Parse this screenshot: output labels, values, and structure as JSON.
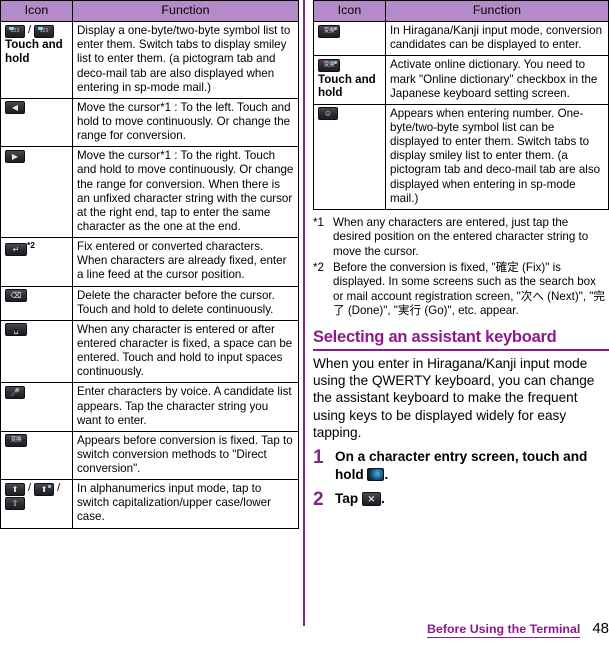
{
  "left_table": {
    "headers": {
      "icon": "Icon",
      "function": "Function"
    },
    "rows": [
      {
        "icons": [
          "123-key",
          "123-key"
        ],
        "icon_separator": "/",
        "icon_note": "Touch and hold",
        "function": "Display a one-byte/two-byte symbol list to enter them. Switch tabs to display smiley list to enter them. (a pictogram tab and deco-mail tab are also displayed when entering in sp-mode mail.)"
      },
      {
        "icons": [
          "arrow-left-key"
        ],
        "function": "Move the cursor*1 : To the left. Touch and hold to move continuously. Or change the range for conversion."
      },
      {
        "icons": [
          "arrow-right-key"
        ],
        "function": "Move the cursor*1 : To the right. Touch and hold to move continuously. Or change the range for conversion. When there is an unfixed character string with the cursor at the right end, tap to enter the same character as the one at the end."
      },
      {
        "icons": [
          "enter-key"
        ],
        "icon_superscript": "*2",
        "function": "Fix entered or converted characters. When characters are already fixed, enter a line feed at the cursor position."
      },
      {
        "icons": [
          "backspace-key"
        ],
        "function": "Delete the character before the cursor. Touch and hold to delete continuously."
      },
      {
        "icons": [
          "space-key"
        ],
        "function": "When any character is entered or after entered character is fixed, a space can be entered. Touch and hold to input spaces continuously."
      },
      {
        "icons": [
          "microphone-key"
        ],
        "function": "Enter characters by voice. A candidate list appears. Tap the character string you want to enter."
      },
      {
        "icons": [
          "conversion-key"
        ],
        "function": "Appears before conversion is fixed. Tap to switch conversion methods to \"Direct conversion\"."
      },
      {
        "icons": [
          "shift-key",
          "shift-key-blue",
          "caps-key"
        ],
        "icon_separator": "/",
        "function": "In alphanumerics input mode, tap to switch capitalization/upper case/lower case."
      }
    ]
  },
  "right_table": {
    "headers": {
      "icon": "Icon",
      "function": "Function"
    },
    "rows": [
      {
        "icons": [
          "conversion-candidate-key"
        ],
        "function": "In Hiragana/Kanji input mode, conversion candidates can be displayed to enter."
      },
      {
        "icons": [
          "conversion-candidate-key"
        ],
        "icon_note": "Touch and hold",
        "function": "Activate online dictionary. You need to mark \"Online dictionary\" checkbox in the Japanese keyboard setting screen."
      },
      {
        "icons": [
          "symbol-key"
        ],
        "function": "Appears when entering number. One-byte/two-byte symbol list can be displayed to enter them. Switch tabs to display smiley list to enter them. (a pictogram tab and deco-mail tab are also displayed when entering in sp-mode mail.)"
      }
    ]
  },
  "footnotes": [
    {
      "mark": "*1",
      "text": "When any characters are entered, just tap the desired position on the entered character string to move the cursor."
    },
    {
      "mark": "*2",
      "text": "Before the conversion is fixed, \"確定 (Fix)\" is displayed. In some screens such as the search box or mail account registration screen, \"次へ (Next)\", \"完了 (Done)\", \"実行 (Go)\", etc. appear."
    }
  ],
  "section": {
    "heading": "Selecting an assistant keyboard",
    "body": "When you enter in Hiragana/Kanji input mode using the QWERTY keyboard, you can change the assistant keyboard to make the frequent using keys to be displayed widely for easy tapping."
  },
  "steps": [
    {
      "number": "1",
      "text_before": "On a character entry screen, touch and hold",
      "icon": "assistant-keyboard-key",
      "text_after": "."
    },
    {
      "number": "2",
      "text_before": "Tap",
      "icon": "close-key",
      "text_after": "."
    }
  ],
  "footer": {
    "label": "Before Using the Terminal",
    "page": "48"
  },
  "colors": {
    "header_purple": "#b48ac8",
    "heading_purple": "#8d1a8d",
    "divider_purple": "#7c2a7c"
  }
}
